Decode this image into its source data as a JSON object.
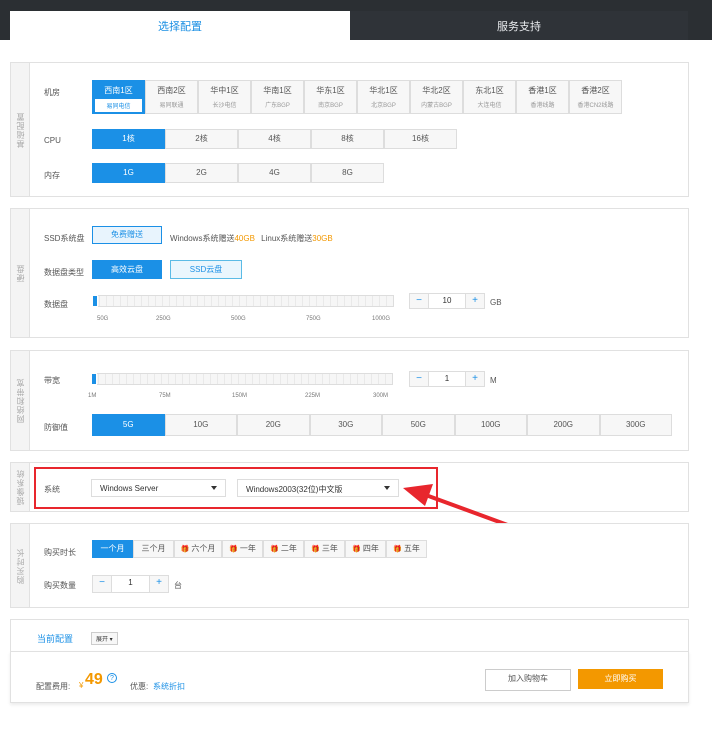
{
  "tabs": [
    "选择配置",
    "服务支持"
  ],
  "sections": {
    "host": "基础配置",
    "disk": "硬盘",
    "network": "网络和带宽",
    "image": "镜像系统",
    "purchase": "购买时长"
  },
  "jifang": {
    "label": "机房",
    "items": [
      {
        "name": "西南1区",
        "sub": "易同电信",
        "selected": true
      },
      {
        "name": "西南2区",
        "sub": "易同联通"
      },
      {
        "name": "华中1区",
        "sub": "长沙电信"
      },
      {
        "name": "华南1区",
        "sub": "广东BGP"
      },
      {
        "name": "华东1区",
        "sub": "南京BGP"
      },
      {
        "name": "华北1区",
        "sub": "北京BGP"
      },
      {
        "name": "华北2区",
        "sub": "内蒙古BGP"
      },
      {
        "name": "东北1区",
        "sub": "大连电信"
      },
      {
        "name": "香港1区",
        "sub": "香港线路"
      },
      {
        "name": "香港2区",
        "sub": "香港CN2线路"
      }
    ]
  },
  "cpu": {
    "label": "CPU",
    "options": [
      "1核",
      "2核",
      "4核",
      "8核",
      "16核"
    ]
  },
  "memory": {
    "label": "内存",
    "options": [
      "1G",
      "2G",
      "4G",
      "8G"
    ]
  },
  "ssd_system": {
    "label": "SSD系统盘",
    "button": "免费赠送",
    "win_text": "Windows系统赠送",
    "win_size": "40GB",
    "linux_text": "Linux系统赠送",
    "linux_size": "30GB"
  },
  "data_disk_type": {
    "label": "数据盘类型",
    "options": [
      "高效云盘",
      "SSD云盘"
    ]
  },
  "data_disk": {
    "label": "数据盘",
    "ticks": [
      "50G",
      "250G",
      "500G",
      "750G",
      "1000G"
    ],
    "value": "10",
    "unit": "GB",
    "minus": "−",
    "plus": "+"
  },
  "bandwidth": {
    "label": "带宽",
    "ticks": [
      "1M",
      "75M",
      "150M",
      "225M",
      "300M"
    ],
    "value": "1",
    "unit": "M",
    "minus": "−",
    "plus": "+"
  },
  "defense": {
    "label": "防御值",
    "options": [
      "5G",
      "10G",
      "20G",
      "30G",
      "50G",
      "100G",
      "200G",
      "300G"
    ]
  },
  "os": {
    "label": "系统",
    "type": "Windows Server",
    "version": "Windows2003(32位)中文版"
  },
  "duration": {
    "label": "购买时长",
    "options": [
      "一个月",
      "三个月",
      "六个月",
      "一年",
      "二年",
      "三年",
      "四年",
      "五年"
    ],
    "gift_icon": "gift-icon"
  },
  "quantity": {
    "label": "购买数量",
    "value": "1",
    "unit": "台",
    "minus": "−",
    "plus": "+"
  },
  "summary": {
    "title": "当前配置",
    "expand": "展开",
    "fee_label": "配置费用:",
    "currency": "¥",
    "price": "49",
    "discount_label": "优惠:",
    "discount_link": "系统折扣",
    "add_cart": "加入购物车",
    "buy_now": "立即购买"
  },
  "colors": {
    "accent": "#1b90e6",
    "orange": "#f39800",
    "annotation": "#e8262d"
  }
}
